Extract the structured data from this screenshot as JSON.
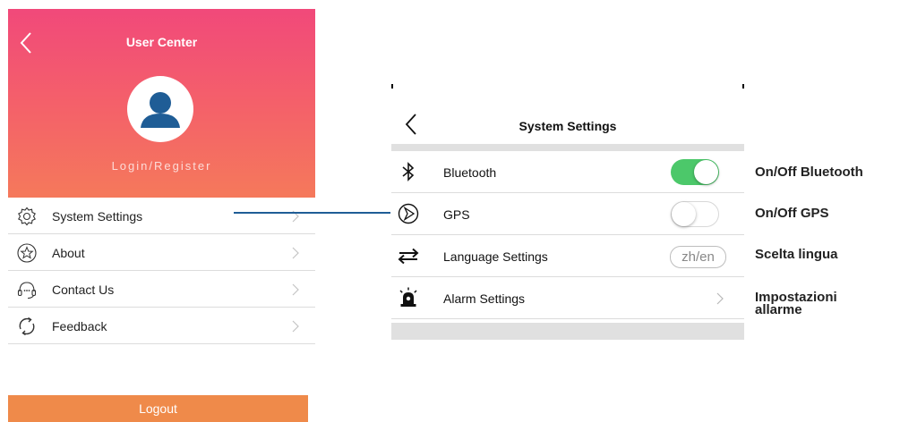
{
  "user_center": {
    "title": "User Center",
    "login_label": "Login/Register",
    "menu": [
      {
        "label": "System Settings",
        "icon": "gear-icon"
      },
      {
        "label": "About",
        "icon": "star-icon"
      },
      {
        "label": "Contact Us",
        "icon": "headset-icon"
      },
      {
        "label": "Feedback",
        "icon": "refresh-icon"
      }
    ],
    "logout_label": "Logout",
    "colors": {
      "header_top": "#f1497a",
      "header_bottom": "#f5795b",
      "logout": "#ef8a4a",
      "avatar": "#1f5d96"
    }
  },
  "system_settings": {
    "title": "System Settings",
    "rows": [
      {
        "label": "Bluetooth",
        "icon": "bluetooth-icon",
        "control": "toggle",
        "on": true
      },
      {
        "label": "GPS",
        "icon": "gps-icon",
        "control": "toggle",
        "on": false
      },
      {
        "label": "Language Settings",
        "icon": "swap-arrows-icon",
        "control": "pill",
        "value": "zh/en"
      },
      {
        "label": "Alarm Settings",
        "icon": "alarm-siren-icon",
        "control": "chevron"
      }
    ],
    "colors": {
      "toggle_on": "#4cc86a",
      "separator": "#e0e0e0"
    }
  },
  "annotations": {
    "bluetooth": "On/Off Bluetooth",
    "gps": "On/Off GPS",
    "language": "Scelta lingua",
    "alarm_line1": "Impostazioni",
    "alarm_line2": "allarme"
  },
  "connector_color": "#1f5d96"
}
